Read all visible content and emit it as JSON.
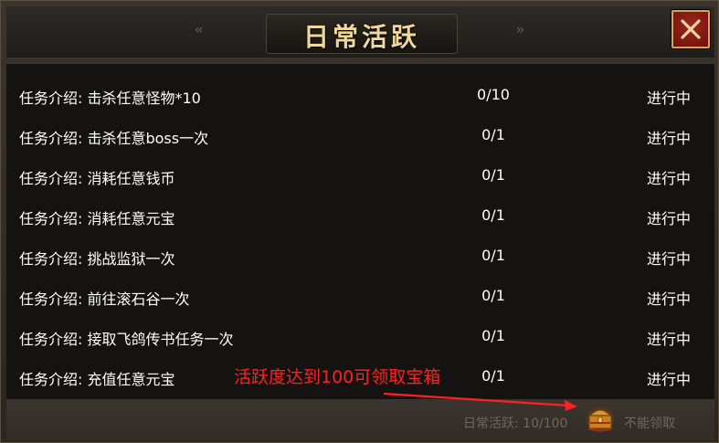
{
  "window": {
    "title": "日常活跃",
    "close_icon": "close-icon",
    "arrow_left_icon": "double-chevron-left-icon",
    "arrow_right_icon": "double-chevron-right-icon"
  },
  "tasks": [
    {
      "desc": "任务介绍: 击杀任意怪物*10",
      "progress": "0/10",
      "status": "进行中"
    },
    {
      "desc": "任务介绍: 击杀任意boss一次",
      "progress": "0/1",
      "status": "进行中"
    },
    {
      "desc": "任务介绍: 消耗任意钱币",
      "progress": "0/1",
      "status": "进行中"
    },
    {
      "desc": "任务介绍: 消耗任意元宝",
      "progress": "0/1",
      "status": "进行中"
    },
    {
      "desc": "任务介绍: 挑战监狱一次",
      "progress": "0/1",
      "status": "进行中"
    },
    {
      "desc": "任务介绍: 前往滚石谷一次",
      "progress": "0/1",
      "status": "进行中"
    },
    {
      "desc": "任务介绍: 接取飞鸽传书任务一次",
      "progress": "0/1",
      "status": "进行中"
    },
    {
      "desc": "任务介绍: 充值任意元宝",
      "progress": "0/1",
      "status": "进行中"
    }
  ],
  "footer": {
    "active_label": "日常活跃: 10/100",
    "chest_icon": "treasure-chest-icon",
    "claim_label": "不能领取"
  },
  "annotation": {
    "text": "活跃度达到100可领取宝箱",
    "color": "#ff2020"
  }
}
